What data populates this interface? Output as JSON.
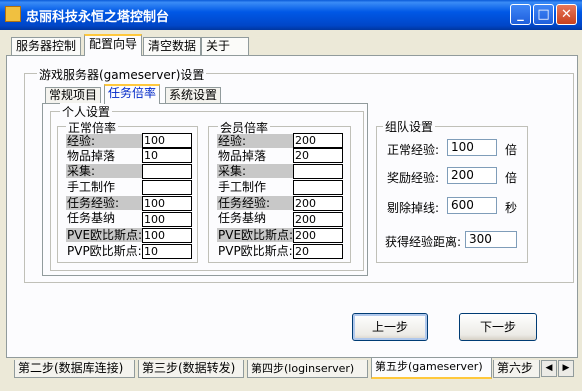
{
  "window": {
    "title": "忠丽科技永恒之塔控制台",
    "controls": {
      "minimize": "_",
      "maximize": "□",
      "close": "✕"
    }
  },
  "outer_tabs": [
    "服务器控制",
    "配置向导",
    "清空数据",
    "关于"
  ],
  "server_group": {
    "title": "游戏服务器(gameserver)设置"
  },
  "inner_tabs": [
    "常规项目",
    "任务倍率",
    "系统设置"
  ],
  "personal": {
    "title": "个人设置",
    "normal": {
      "title": "正常倍率",
      "fields": [
        {
          "label": "经验:",
          "value": "100"
        },
        {
          "label": "物品掉落",
          "value": "10"
        },
        {
          "label": "采集:",
          "value": ""
        },
        {
          "label": "手工制作",
          "value": ""
        },
        {
          "label": "任务经验:",
          "value": "100"
        },
        {
          "label": "任务基纳",
          "value": "100"
        },
        {
          "label": "PVE欧比斯点:",
          "value": "100"
        },
        {
          "label": "PVP欧比斯点:",
          "value": "10"
        }
      ]
    },
    "member": {
      "title": "会员倍率",
      "fields": [
        {
          "label": "经验:",
          "value": "200"
        },
        {
          "label": "物品掉落",
          "value": "20"
        },
        {
          "label": "采集:",
          "value": ""
        },
        {
          "label": "手工制作",
          "value": ""
        },
        {
          "label": "任务经验:",
          "value": "200"
        },
        {
          "label": "任务基纳",
          "value": "200"
        },
        {
          "label": "PVE欧比斯点:",
          "value": "200"
        },
        {
          "label": "PVP欧比斯点:",
          "value": "20"
        }
      ]
    }
  },
  "team": {
    "title": "组队设置",
    "normal_exp": {
      "label": "正常经验:",
      "value": "100",
      "unit": "倍"
    },
    "reward_exp": {
      "label": "奖励经验:",
      "value": "200",
      "unit": "倍"
    },
    "kick_disconnect": {
      "label": "剔除掉线:",
      "value": "600",
      "unit": "秒"
    },
    "exp_distance": {
      "label": "获得经验距离:",
      "value": "300"
    }
  },
  "nav": {
    "prev": "上一步",
    "next": "下一步"
  },
  "bottom_tabs": [
    "第二步(数据库连接)",
    "第三步(数据转发)",
    "第四步(loginserver)",
    "第五步(gameserver)",
    "第六步"
  ],
  "scroll": {
    "left": "◀",
    "right": "▶"
  }
}
